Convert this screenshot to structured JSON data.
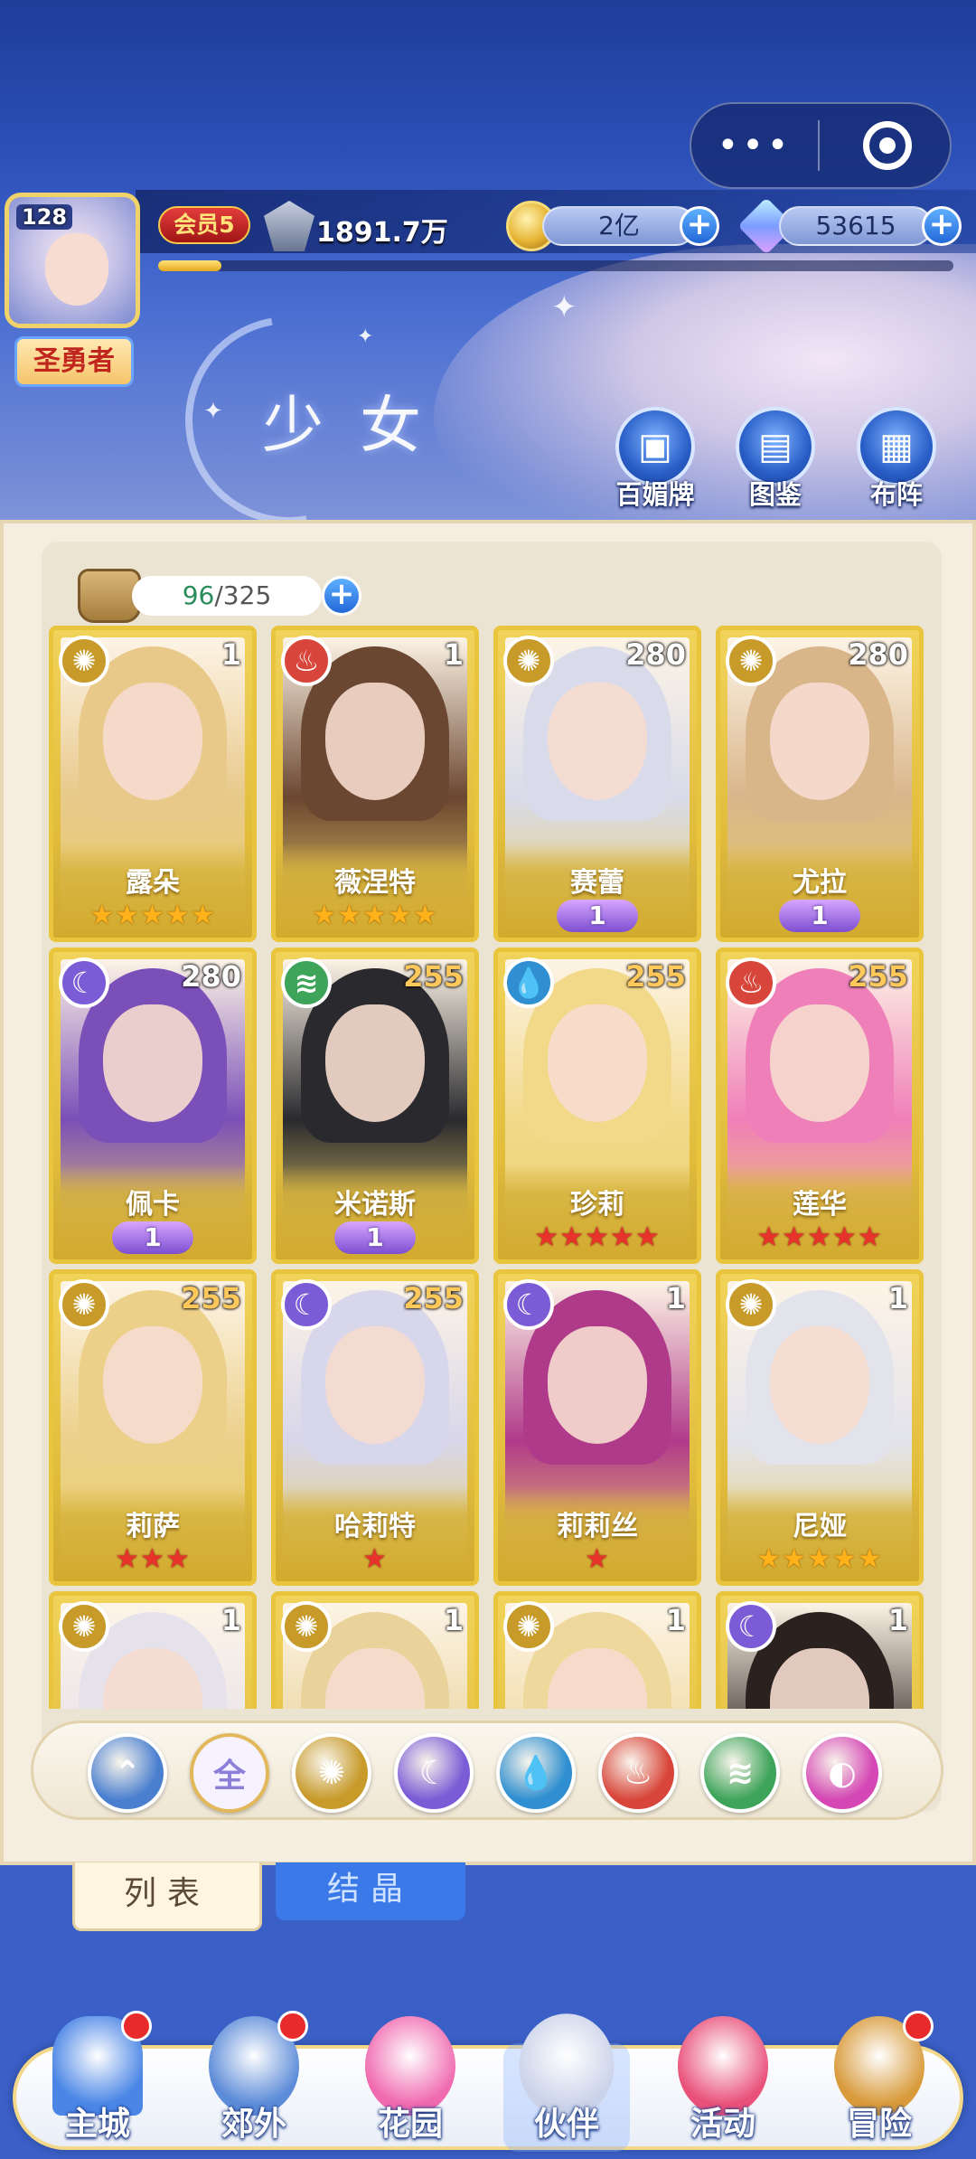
{
  "topbar": {
    "more_glyph": "•••",
    "close_glyph": "◉"
  },
  "player": {
    "level": "128",
    "title": "圣勇者",
    "vip": "会员5",
    "power": "1891.7万",
    "exp_fraction": 0.08
  },
  "resources": [
    {
      "name": "gold",
      "value": "2亿"
    },
    {
      "name": "diamond",
      "value": "53615"
    }
  ],
  "section_title": "少女",
  "header_buttons": [
    {
      "label": "百媚牌",
      "icon": "card-deck-icon"
    },
    {
      "label": "图鉴",
      "icon": "book-icon"
    },
    {
      "label": "布阵",
      "icon": "formation-grid-icon"
    }
  ],
  "bag": {
    "current": "96",
    "total": "/325"
  },
  "cards": [
    {
      "name": "露朵",
      "level": "1",
      "element": "sun",
      "stars": "★★★★★",
      "star_color": "gold",
      "wing": null,
      "hair": "#e8c98a"
    },
    {
      "name": "薇涅特",
      "level": "1",
      "element": "fire",
      "stars": "★★★★★",
      "star_color": "gold",
      "wing": null,
      "hair": "#6b4630"
    },
    {
      "name": "赛蕾",
      "level": "280",
      "element": "sun",
      "stars": null,
      "star_color": null,
      "wing": "1",
      "hair": "#d9dbea"
    },
    {
      "name": "尤拉",
      "level": "280",
      "element": "sun",
      "stars": null,
      "star_color": null,
      "wing": "1",
      "hair": "#d9b58a"
    },
    {
      "name": "佩卡",
      "level": "280",
      "element": "moon",
      "stars": null,
      "star_color": null,
      "wing": "1",
      "hair": "#7a4fb8"
    },
    {
      "name": "米诺斯",
      "level": "255",
      "element": "wind",
      "stars": null,
      "star_color": null,
      "wing": "1",
      "hair": "#2a2a2e"
    },
    {
      "name": "珍莉",
      "level": "255",
      "element": "water",
      "stars": "★★★★★",
      "star_color": "red",
      "wing": null,
      "hair": "#f2d98a"
    },
    {
      "name": "莲华",
      "level": "255",
      "element": "fire",
      "stars": "★★★★★",
      "star_color": "red",
      "wing": null,
      "hair": "#ef7fb8"
    },
    {
      "name": "莉萨",
      "level": "255",
      "element": "sun",
      "stars": "★★★",
      "star_color": "red",
      "wing": null,
      "hair": "#ecd08a"
    },
    {
      "name": "哈莉特",
      "level": "255",
      "element": "moon",
      "stars": "★",
      "star_color": "red",
      "wing": null,
      "hair": "#d8d6ea"
    },
    {
      "name": "莉莉丝",
      "level": "1",
      "element": "moon",
      "stars": "★",
      "star_color": "red",
      "wing": null,
      "hair": "#b03a8a"
    },
    {
      "name": "尼娅",
      "level": "1",
      "element": "sun",
      "stars": "★★★★★",
      "star_color": "gold",
      "wing": null,
      "hair": "#e3e3ec"
    },
    {
      "name": "",
      "level": "1",
      "element": "sun",
      "stars": null,
      "star_color": null,
      "wing": null,
      "hair": "#e6e2ec"
    },
    {
      "name": "",
      "level": "1",
      "element": "sun",
      "stars": null,
      "star_color": null,
      "wing": null,
      "hair": "#e9d39a"
    },
    {
      "name": "",
      "level": "1",
      "element": "sun",
      "stars": null,
      "star_color": null,
      "wing": null,
      "hair": "#efd89c"
    },
    {
      "name": "",
      "level": "1",
      "element": "moon",
      "stars": null,
      "star_color": null,
      "wing": null,
      "hair": "#2b2220"
    }
  ],
  "elements": {
    "sun": {
      "color": "#c79a2a",
      "glyph": "✺",
      "icon": "sun-icon"
    },
    "fire": {
      "color": "#d8453a",
      "glyph": "♨",
      "icon": "fire-icon"
    },
    "moon": {
      "color": "#7b5bd6",
      "glyph": "☾",
      "icon": "moon-icon"
    },
    "water": {
      "color": "#2f8fd0",
      "glyph": "💧",
      "icon": "water-drop-icon"
    },
    "wind": {
      "color": "#3da45a",
      "glyph": "≋",
      "icon": "wind-icon"
    }
  },
  "filters": [
    {
      "key": "ascend",
      "label": "⌃",
      "color": "#4a7fd0",
      "icon": "ascend-icon"
    },
    {
      "key": "all",
      "label": "全",
      "color": "#8d7ed8",
      "icon": "all-icon"
    },
    {
      "key": "sun",
      "label": "✺",
      "color": "#c79a2a",
      "icon": "sun-icon"
    },
    {
      "key": "moon",
      "label": "☾",
      "color": "#7b5bd6",
      "icon": "moon-icon"
    },
    {
      "key": "water",
      "label": "💧",
      "color": "#2f8fd0",
      "icon": "water-drop-icon"
    },
    {
      "key": "fire",
      "label": "♨",
      "color": "#d8453a",
      "icon": "fire-icon"
    },
    {
      "key": "wind",
      "label": "≋",
      "color": "#3da45a",
      "icon": "wind-icon"
    },
    {
      "key": "charm",
      "label": "◐",
      "color": "#d447b4",
      "icon": "charm-icon"
    }
  ],
  "tabs": {
    "list": "列表",
    "crystal": "结晶"
  },
  "nav": [
    {
      "label": "主城",
      "badge": true,
      "icon": "castle-icon",
      "color": "#4b86e6"
    },
    {
      "label": "郊外",
      "badge": true,
      "icon": "portal-icon",
      "color": "#5c8bd8"
    },
    {
      "label": "花园",
      "badge": false,
      "icon": "heart-icon",
      "color": "#f06ab0"
    },
    {
      "label": "伙伴",
      "badge": false,
      "icon": "partner-icon",
      "color": "#cbd3ea"
    },
    {
      "label": "活动",
      "badge": false,
      "icon": "gift-icon",
      "color": "#e9517a"
    },
    {
      "label": "冒险",
      "badge": true,
      "icon": "compass-icon",
      "color": "#d89a3a"
    }
  ]
}
